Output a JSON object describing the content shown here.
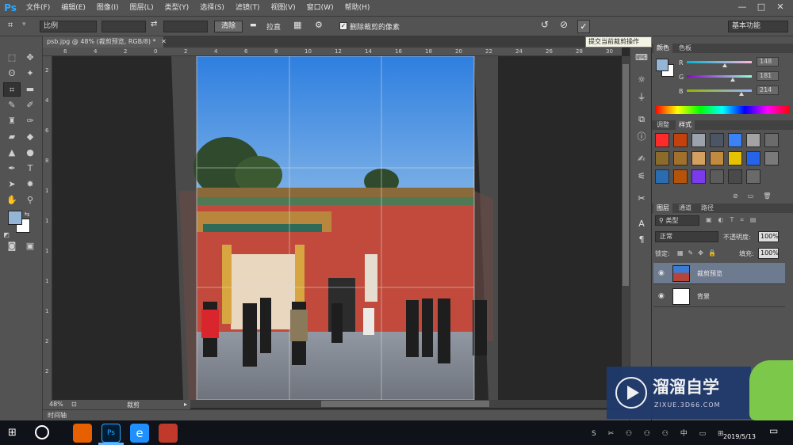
{
  "app": {
    "logo": "Ps"
  },
  "menu": [
    "文件(F)",
    "编辑(E)",
    "图像(I)",
    "图层(L)",
    "类型(Y)",
    "选择(S)",
    "滤镜(T)",
    "视图(V)",
    "窗口(W)",
    "帮助(H)"
  ],
  "window_controls": {
    "minimize": "—",
    "restore": "□",
    "close": "✕"
  },
  "options_bar": {
    "ratio_select": "比例",
    "clear_button": "清除",
    "straighten_label": "拉直",
    "delete_cropped_label": "删除裁剪的像素",
    "delete_cropped_checked": true,
    "workspace_select": "基本功能"
  },
  "tooltip": "提交当前裁剪操作",
  "document": {
    "tab_title": "psb.jpg @ 48% (裁剪预览, RGB/8) *",
    "zoom": "48%",
    "status_mode": "裁剪",
    "timeline_label": "时间轴"
  },
  "ruler_top_numbers": [
    "6",
    "4",
    "2",
    "0",
    "2",
    "4",
    "6",
    "8",
    "10",
    "12",
    "14",
    "16",
    "18",
    "20",
    "22",
    "24",
    "26",
    "28",
    "30"
  ],
  "ruler_left_numbers": [
    "2",
    "4",
    "6",
    "8",
    "1",
    "1",
    "1",
    "1",
    "1",
    "2",
    "2"
  ],
  "color_panel": {
    "tabs": [
      "颜色",
      "色板"
    ],
    "sliders": [
      {
        "label": "R",
        "value": "148",
        "fraction": 0.58
      },
      {
        "label": "G",
        "value": "181",
        "fraction": 0.71
      },
      {
        "label": "B",
        "value": "214",
        "fraction": 0.84
      }
    ],
    "foreground_color": "#94b5d6",
    "background_color": "#ffffff"
  },
  "styles_panel": {
    "tabs": [
      "调整",
      "样式"
    ]
  },
  "layers_panel": {
    "tabs": [
      "图层",
      "通道",
      "路径"
    ],
    "filter_select": "类型",
    "blend_mode": "正常",
    "opacity_label": "不透明度:",
    "opacity_value": "100%",
    "lock_label": "锁定:",
    "fill_label": "填充:",
    "fill_value": "100%",
    "layers": [
      {
        "name": "裁剪预览",
        "selected": true
      },
      {
        "name": "背景",
        "selected": false
      }
    ]
  },
  "watermark": {
    "brand": "溜溜自学",
    "url": "ZIXUE.3D66.COM"
  },
  "taskbar": {
    "clock_date": "2019/5/13"
  }
}
